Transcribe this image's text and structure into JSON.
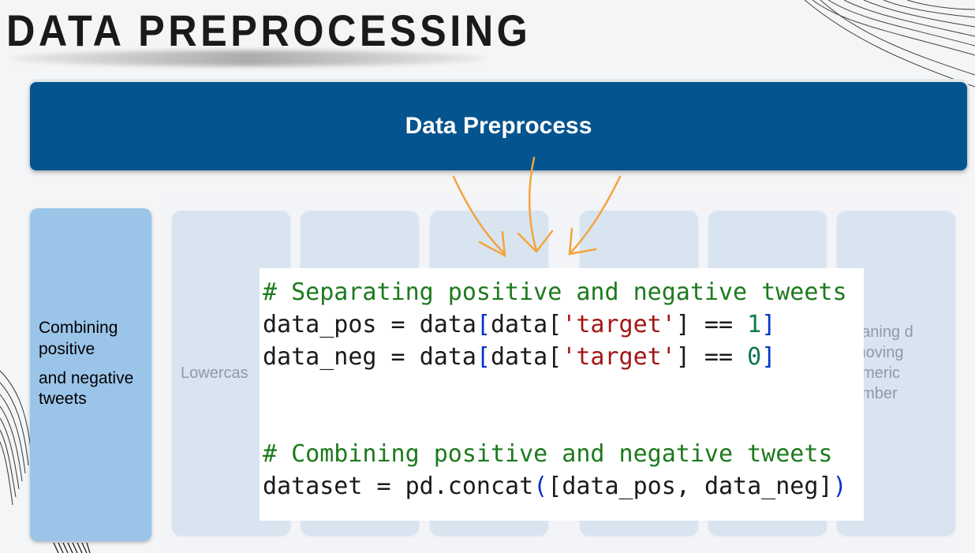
{
  "slide": {
    "title": "DATA PREPROCESSING"
  },
  "header": {
    "label": "Data Preprocess"
  },
  "left_card": {
    "line1": "Combining positive",
    "line2": "and negative tweets"
  },
  "steps": [
    {
      "label": "Lowercas"
    },
    {
      "label": ""
    },
    {
      "label": ""
    },
    {
      "label": ""
    },
    {
      "label": ""
    },
    {
      "label": "eaning d moving umeric umber"
    }
  ],
  "code": {
    "comment1": "# Separating positive and negative tweets",
    "comment2": "# Combining positive and negative tweets",
    "var_pos": "data_pos",
    "var_neg": "data_neg",
    "var_dataset": "dataset",
    "df": "data",
    "column": "'target'",
    "val_pos": "1",
    "val_neg": "0",
    "func": "pd.concat"
  },
  "colors": {
    "header_blue": "#04548f",
    "card_blue": "#9bc4e9",
    "step_blue": "#d8e5f1",
    "arrow_orange": "#f4a33a",
    "comment_green": "#1d7a1d",
    "string_red": "#a31515",
    "bracket_blue": "#0033cc"
  }
}
